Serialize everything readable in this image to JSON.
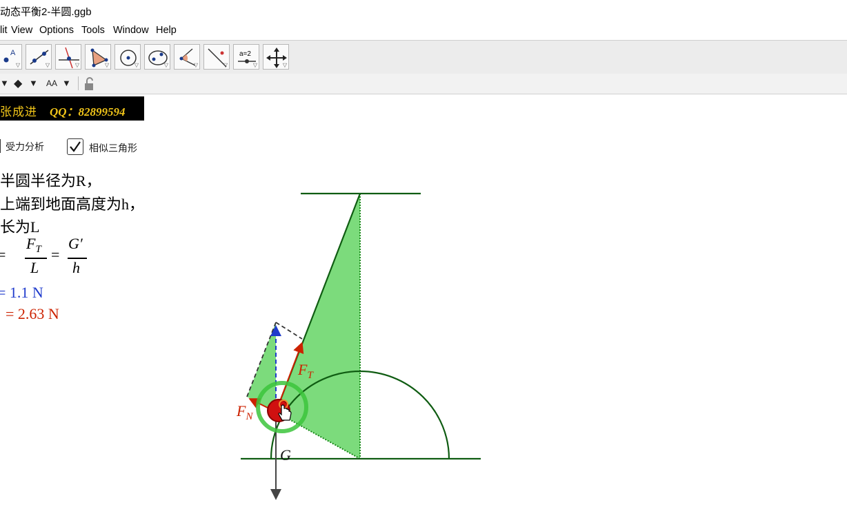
{
  "window": {
    "title": "动态平衡2-半圆.ggb"
  },
  "menu": [
    "lit",
    "View",
    "Options",
    "Tools",
    "Window",
    "Help"
  ],
  "toolbar": {
    "tools": [
      "point-tool",
      "line-tool",
      "perpendicular-tool",
      "polygon-tool",
      "circle-tool",
      "conic-tool",
      "angle-tool",
      "reflect-tool",
      "slider-tool",
      "move-graphics-tool"
    ],
    "slider_label": "a=2"
  },
  "stylebar": {
    "text_size_label": "AA"
  },
  "banner": {
    "author": "张成进",
    "qq": "QQ：82899594"
  },
  "checkboxes": [
    {
      "label": "受力分析",
      "checked": true
    },
    {
      "label": "相似三角形",
      "checked": true
    }
  ],
  "text": {
    "line1": "半圆半径为R，",
    "line2": "上端到地面高度为h，",
    "line3": "长为L",
    "ratio_prefix": "= ",
    "ft_num": "F",
    "ft_sub": "T",
    "ft_den": "L",
    "eq2": "=",
    "g_num": "G′",
    "g_den": "h",
    "ft_value": "= 1.1 N",
    "fn_value": "= 2.63 N"
  },
  "labels": {
    "ft": "F",
    "ft_sub": "T",
    "fn": "F",
    "fn_sub": "N",
    "g": "G"
  },
  "colors": {
    "line_dark_green": "#0f5c12",
    "fill_green": "#5fd35f",
    "force_red": "#cc2200",
    "force_blue": "#1f3bcc",
    "ring_green": "#3cc43c",
    "ball_red": "#d01010",
    "banner_gold": "#f0c419"
  }
}
